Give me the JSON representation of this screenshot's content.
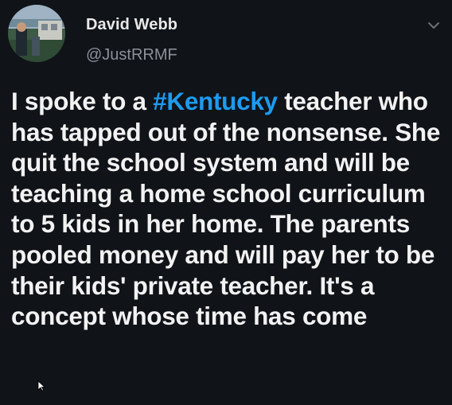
{
  "tweet": {
    "display_name": "David Webb",
    "handle": "@JustRRMF",
    "text_before": "I spoke to a ",
    "hashtag": "#Kentucky",
    "text_after": " teacher who has tapped out of the nonsense. She quit the school system and will be teaching a home school curriculum to 5 kids in her home. The parents pooled money and will pay her to be their kids' private teacher. It's a concept whose time has come"
  },
  "icons": {
    "menu": "chevron-down-icon",
    "cursor": "mouse-cursor-icon"
  },
  "colors": {
    "background": "#101318",
    "text": "#f2f2f2",
    "hashtag": "#1d9bf0",
    "handle": "#8b9099"
  }
}
